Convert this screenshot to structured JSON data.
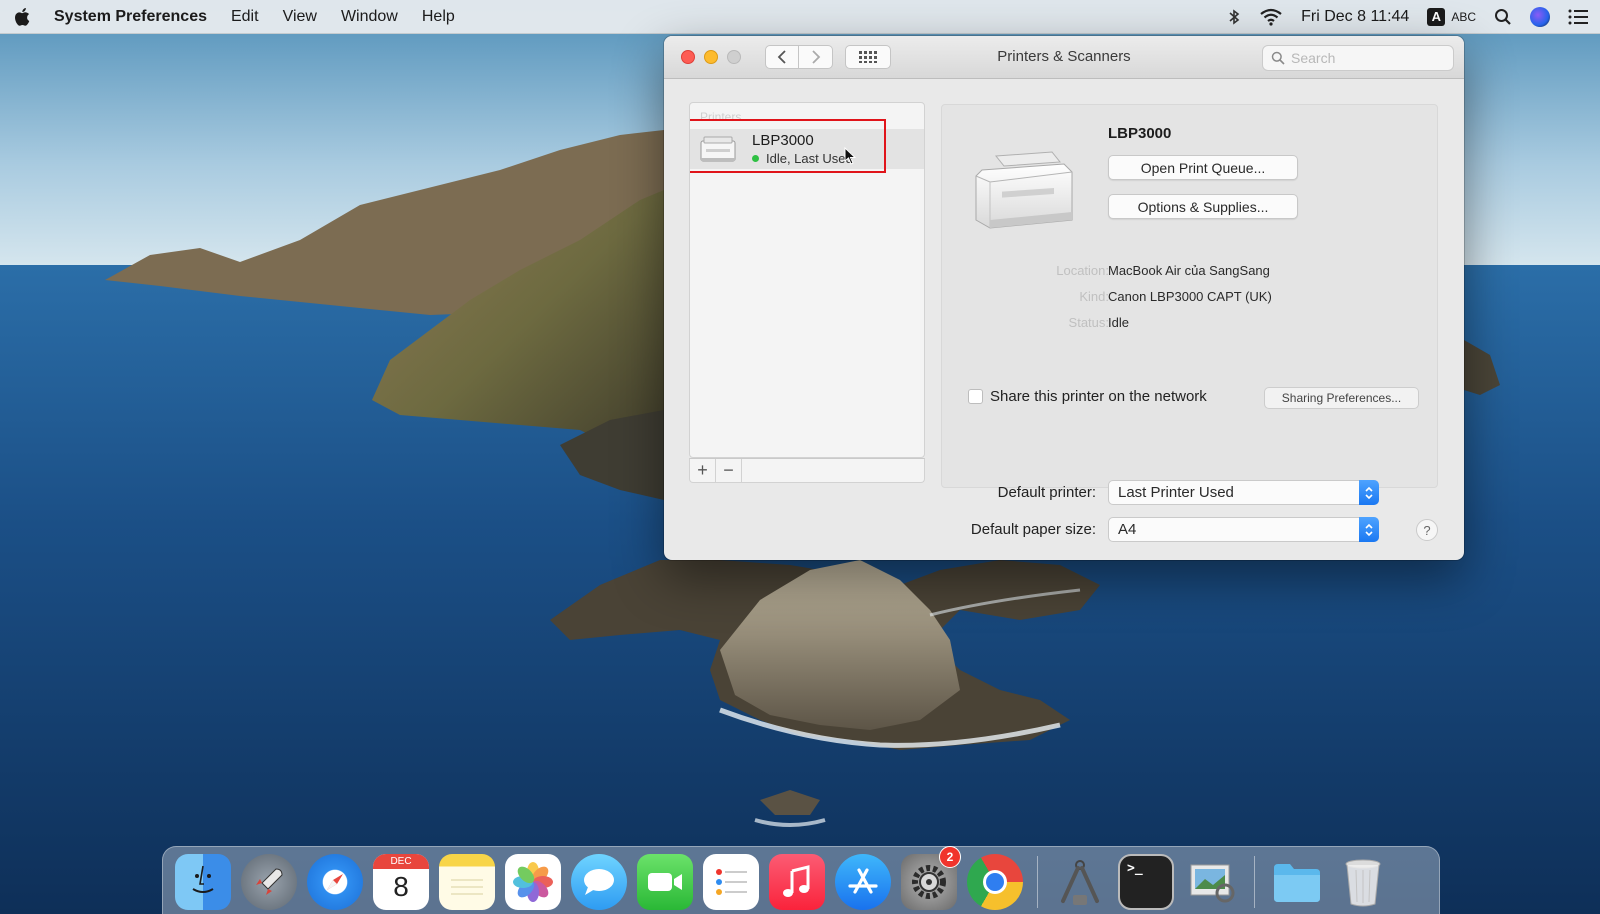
{
  "menubar": {
    "app_name": "System Preferences",
    "menus": [
      "Edit",
      "View",
      "Window",
      "Help"
    ],
    "clock": "Fri Dec 8  11:44",
    "input_badge": "A",
    "input_source": "ABC"
  },
  "window": {
    "title": "Printers & Scanners",
    "search_placeholder": "Search"
  },
  "printer_list": {
    "header": "Printers",
    "items": [
      {
        "name": "LBP3000",
        "status": "Idle, Last Used",
        "status_color": "#2fc043"
      }
    ],
    "add_label": "+",
    "remove_label": "−"
  },
  "printer_detail": {
    "name": "LBP3000",
    "open_queue_label": "Open Print Queue...",
    "options_label": "Options & Supplies...",
    "location_label": "Location:",
    "location_value": "MacBook Air của SangSang",
    "kind_label": "Kind:",
    "kind_value": "Canon LBP3000 CAPT (UK)",
    "status_label": "Status:",
    "status_value": "Idle",
    "share_label": "Share this printer on the network",
    "sharing_prefs_label": "Sharing Preferences..."
  },
  "defaults": {
    "default_printer_label": "Default printer:",
    "default_printer_value": "Last Printer Used",
    "paper_size_label": "Default paper size:",
    "paper_size_value": "A4",
    "help_label": "?"
  },
  "dock": {
    "calendar_month": "DEC",
    "calendar_day": "8",
    "system_prefs_badge": "2",
    "terminal_prompt": ">_"
  },
  "colors": {
    "highlight": "#e0141a",
    "accent": "#1a78f2"
  }
}
